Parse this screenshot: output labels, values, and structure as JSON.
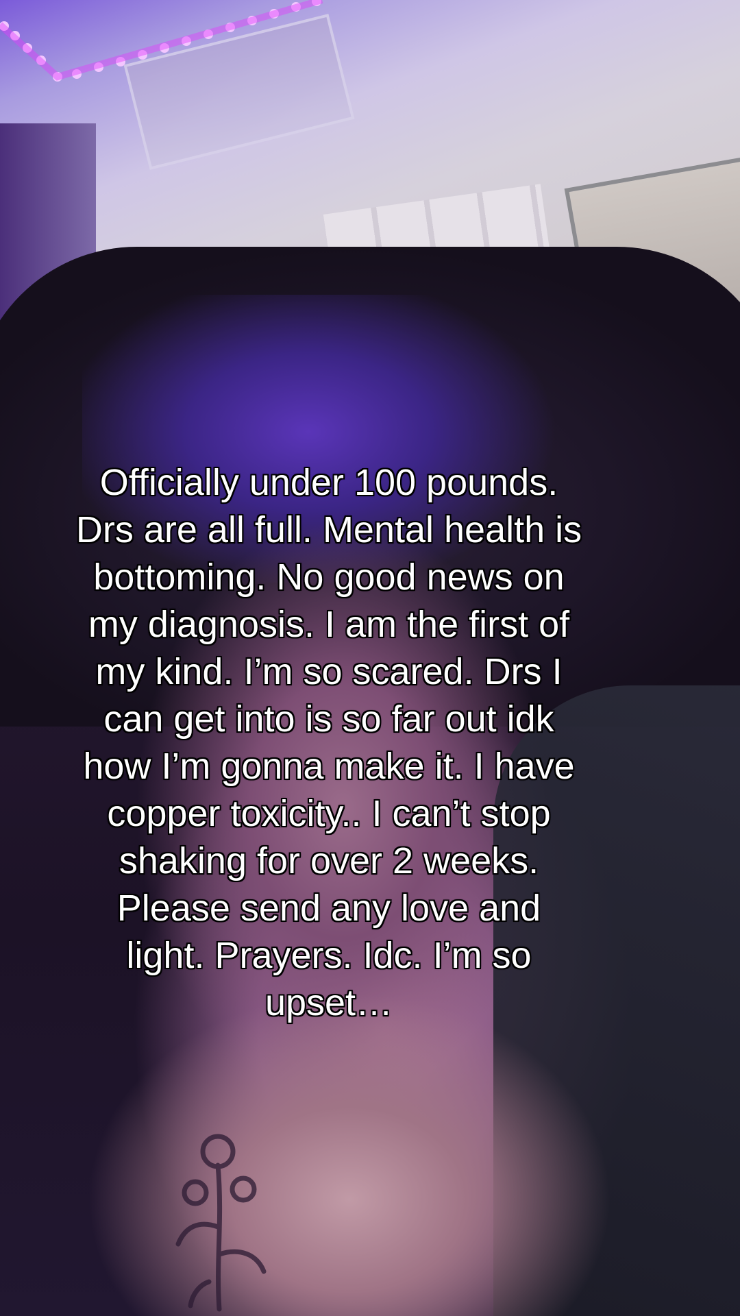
{
  "overlay": {
    "caption": "Officially under 100 pounds.\nDrs are all full. Mental health is\nbottoming. No good news on\nmy diagnosis. I am the first of\nmy kind. I’m so scared. Drs I\ncan get into is so far out idk\nhow I’m gonna make it. I have\ncopper toxicity.. I can’t stop\nshaking for over 2 weeks.\nPlease send any love and\nlight. Prayers. Idc. I’m so\nupset…"
  },
  "colors": {
    "led": "#e040fb",
    "caption_text": "#ffffff",
    "caption_outline": "#000000"
  }
}
